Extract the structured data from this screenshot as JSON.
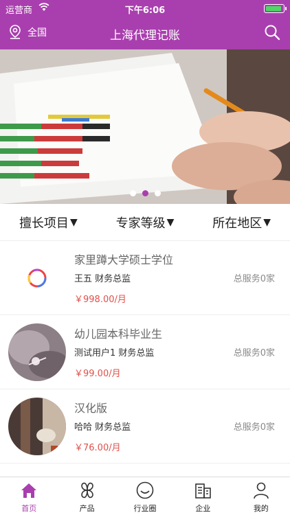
{
  "status": {
    "carrier": "运营商",
    "time": "下午6:06",
    "battery_level": 0.9
  },
  "nav": {
    "location": "全国",
    "title": "上海代理记账"
  },
  "banner": {
    "slides": 3,
    "active_index": 1
  },
  "filters": [
    {
      "label": "擅长项目",
      "arrow": "▼"
    },
    {
      "label": "专家等级",
      "arrow": "▼"
    },
    {
      "label": "所在地区",
      "arrow": "▼"
    }
  ],
  "items": [
    {
      "name": "家里蹲大学硕士学位",
      "role": "王五 财务总监",
      "served": "总服务0家",
      "price": "￥998.00/月"
    },
    {
      "name": "幼儿园本科毕业生",
      "role": "测试用户1 财务总监",
      "served": "总服务0家",
      "price": "￥99.00/月"
    },
    {
      "name": "汉化版",
      "role": "哈哈 财务总监",
      "served": "总服务0家",
      "price": "￥76.00/月"
    }
  ],
  "tabs": [
    {
      "label": "首页",
      "icon": "home-icon"
    },
    {
      "label": "产品",
      "icon": "product-icon"
    },
    {
      "label": "行业圈",
      "icon": "circle-icon"
    },
    {
      "label": "企业",
      "icon": "company-icon"
    },
    {
      "label": "我的",
      "icon": "user-icon"
    }
  ],
  "colors": {
    "brand": "#a93fae",
    "price": "#e0504a"
  }
}
